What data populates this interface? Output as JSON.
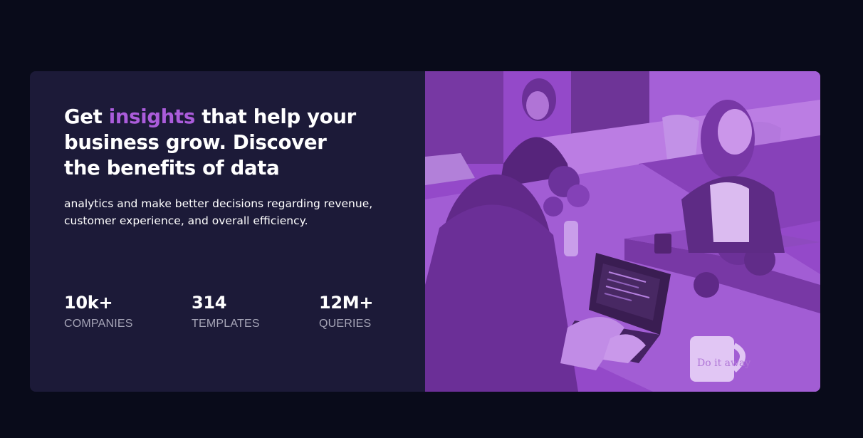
{
  "hero": {
    "headline_start": "Get ",
    "headline_accent": "insights",
    "headline_end": " that help your business grow. Discover the benefits of data",
    "body": "analytics and make better decisions regarding revenue, customer experience, and overall efficiency."
  },
  "stats": [
    {
      "value": "10k+",
      "label": "COMPANIES"
    },
    {
      "value": "314",
      "label": "TEMPLATES"
    },
    {
      "value": "12M+",
      "label": "QUERIES"
    }
  ],
  "image": {
    "overlay_color": "#aa5cdb",
    "mug_text": "Do it away"
  },
  "colors": {
    "page_background": "#090b1a",
    "card_background": "#1c1a38",
    "accent": "#ab5cdb",
    "heading": "#ffffff",
    "muted": "#a6a5b7"
  }
}
